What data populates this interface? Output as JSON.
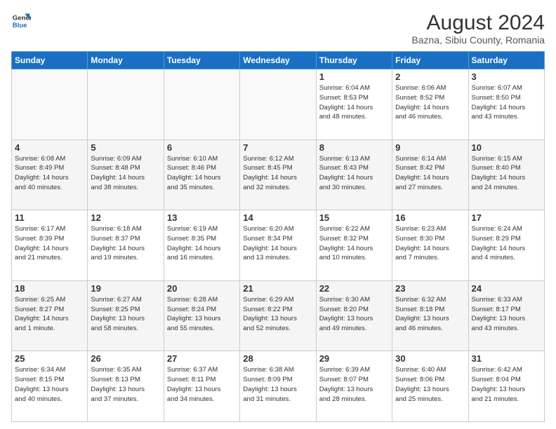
{
  "header": {
    "logo_line1": "General",
    "logo_line2": "Blue",
    "title": "August 2024",
    "subtitle": "Bazna, Sibiu County, Romania"
  },
  "weekdays": [
    "Sunday",
    "Monday",
    "Tuesday",
    "Wednesday",
    "Thursday",
    "Friday",
    "Saturday"
  ],
  "weeks": [
    [
      {
        "day": "",
        "info": ""
      },
      {
        "day": "",
        "info": ""
      },
      {
        "day": "",
        "info": ""
      },
      {
        "day": "",
        "info": ""
      },
      {
        "day": "1",
        "info": "Sunrise: 6:04 AM\nSunset: 8:53 PM\nDaylight: 14 hours\nand 48 minutes."
      },
      {
        "day": "2",
        "info": "Sunrise: 6:06 AM\nSunset: 8:52 PM\nDaylight: 14 hours\nand 46 minutes."
      },
      {
        "day": "3",
        "info": "Sunrise: 6:07 AM\nSunset: 8:50 PM\nDaylight: 14 hours\nand 43 minutes."
      }
    ],
    [
      {
        "day": "4",
        "info": "Sunrise: 6:08 AM\nSunset: 8:49 PM\nDaylight: 14 hours\nand 40 minutes."
      },
      {
        "day": "5",
        "info": "Sunrise: 6:09 AM\nSunset: 8:48 PM\nDaylight: 14 hours\nand 38 minutes."
      },
      {
        "day": "6",
        "info": "Sunrise: 6:10 AM\nSunset: 8:46 PM\nDaylight: 14 hours\nand 35 minutes."
      },
      {
        "day": "7",
        "info": "Sunrise: 6:12 AM\nSunset: 8:45 PM\nDaylight: 14 hours\nand 32 minutes."
      },
      {
        "day": "8",
        "info": "Sunrise: 6:13 AM\nSunset: 8:43 PM\nDaylight: 14 hours\nand 30 minutes."
      },
      {
        "day": "9",
        "info": "Sunrise: 6:14 AM\nSunset: 8:42 PM\nDaylight: 14 hours\nand 27 minutes."
      },
      {
        "day": "10",
        "info": "Sunrise: 6:15 AM\nSunset: 8:40 PM\nDaylight: 14 hours\nand 24 minutes."
      }
    ],
    [
      {
        "day": "11",
        "info": "Sunrise: 6:17 AM\nSunset: 8:39 PM\nDaylight: 14 hours\nand 21 minutes."
      },
      {
        "day": "12",
        "info": "Sunrise: 6:18 AM\nSunset: 8:37 PM\nDaylight: 14 hours\nand 19 minutes."
      },
      {
        "day": "13",
        "info": "Sunrise: 6:19 AM\nSunset: 8:35 PM\nDaylight: 14 hours\nand 16 minutes."
      },
      {
        "day": "14",
        "info": "Sunrise: 6:20 AM\nSunset: 8:34 PM\nDaylight: 14 hours\nand 13 minutes."
      },
      {
        "day": "15",
        "info": "Sunrise: 6:22 AM\nSunset: 8:32 PM\nDaylight: 14 hours\nand 10 minutes."
      },
      {
        "day": "16",
        "info": "Sunrise: 6:23 AM\nSunset: 8:30 PM\nDaylight: 14 hours\nand 7 minutes."
      },
      {
        "day": "17",
        "info": "Sunrise: 6:24 AM\nSunset: 8:29 PM\nDaylight: 14 hours\nand 4 minutes."
      }
    ],
    [
      {
        "day": "18",
        "info": "Sunrise: 6:25 AM\nSunset: 8:27 PM\nDaylight: 14 hours\nand 1 minute."
      },
      {
        "day": "19",
        "info": "Sunrise: 6:27 AM\nSunset: 8:25 PM\nDaylight: 13 hours\nand 58 minutes."
      },
      {
        "day": "20",
        "info": "Sunrise: 6:28 AM\nSunset: 8:24 PM\nDaylight: 13 hours\nand 55 minutes."
      },
      {
        "day": "21",
        "info": "Sunrise: 6:29 AM\nSunset: 8:22 PM\nDaylight: 13 hours\nand 52 minutes."
      },
      {
        "day": "22",
        "info": "Sunrise: 6:30 AM\nSunset: 8:20 PM\nDaylight: 13 hours\nand 49 minutes."
      },
      {
        "day": "23",
        "info": "Sunrise: 6:32 AM\nSunset: 8:18 PM\nDaylight: 13 hours\nand 46 minutes."
      },
      {
        "day": "24",
        "info": "Sunrise: 6:33 AM\nSunset: 8:17 PM\nDaylight: 13 hours\nand 43 minutes."
      }
    ],
    [
      {
        "day": "25",
        "info": "Sunrise: 6:34 AM\nSunset: 8:15 PM\nDaylight: 13 hours\nand 40 minutes."
      },
      {
        "day": "26",
        "info": "Sunrise: 6:35 AM\nSunset: 8:13 PM\nDaylight: 13 hours\nand 37 minutes."
      },
      {
        "day": "27",
        "info": "Sunrise: 6:37 AM\nSunset: 8:11 PM\nDaylight: 13 hours\nand 34 minutes."
      },
      {
        "day": "28",
        "info": "Sunrise: 6:38 AM\nSunset: 8:09 PM\nDaylight: 13 hours\nand 31 minutes."
      },
      {
        "day": "29",
        "info": "Sunrise: 6:39 AM\nSunset: 8:07 PM\nDaylight: 13 hours\nand 28 minutes."
      },
      {
        "day": "30",
        "info": "Sunrise: 6:40 AM\nSunset: 8:06 PM\nDaylight: 13 hours\nand 25 minutes."
      },
      {
        "day": "31",
        "info": "Sunrise: 6:42 AM\nSunset: 8:04 PM\nDaylight: 13 hours\nand 21 minutes."
      }
    ]
  ]
}
